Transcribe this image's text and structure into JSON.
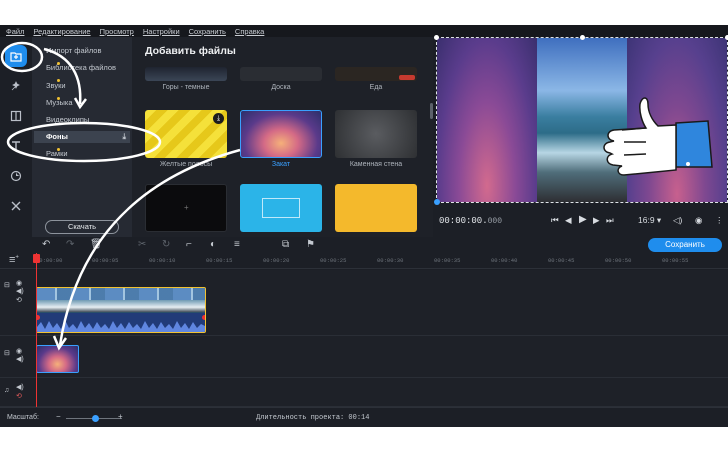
{
  "menu": [
    "Файл",
    "Редактирование",
    "Просмотр",
    "Настройки",
    "Сохранить",
    "Справка"
  ],
  "rail_tools": [
    "import-icon",
    "filters-icon",
    "transitions-icon",
    "titles-icon",
    "stickers-icon",
    "tools-icon"
  ],
  "categories": {
    "items": [
      "Импорт файлов",
      "Библиотека файлов",
      "Звуки",
      "Музыка",
      "Видеоклипы",
      "Фоны",
      "Рамки"
    ],
    "download_button": "Скачать"
  },
  "files": {
    "title": "Добавить файлы",
    "items": [
      {
        "label": "Горы - темные"
      },
      {
        "label": "Доска"
      },
      {
        "label": "Еда"
      },
      {
        "label": "Желтые полосы"
      },
      {
        "label": "Закат"
      },
      {
        "label": "Каменная стена"
      }
    ]
  },
  "preview": {
    "timecode_main": "00:00:00.",
    "timecode_ms": "000",
    "aspect_ratio": "16:9"
  },
  "toolbar": {
    "save_label": "Сохранить"
  },
  "ruler": {
    "ticks": [
      "00:00:00",
      "00:00:05",
      "00:00:10",
      "00:00:15",
      "00:00:20",
      "00:00:25",
      "00:00:30",
      "00:00:35",
      "00:00:40",
      "00:00:45",
      "00:00:50",
      "00:00:55"
    ]
  },
  "status": {
    "zoom_label": "Масштаб:",
    "zoom_minus": "−",
    "zoom_plus": "+",
    "duration_label": "Длительность проекта: 00:14"
  },
  "colors": {
    "accent": "#1f8ded",
    "selection": "#3aa0ff",
    "playhead": "#e33333",
    "clip_border": "#f1c232"
  }
}
